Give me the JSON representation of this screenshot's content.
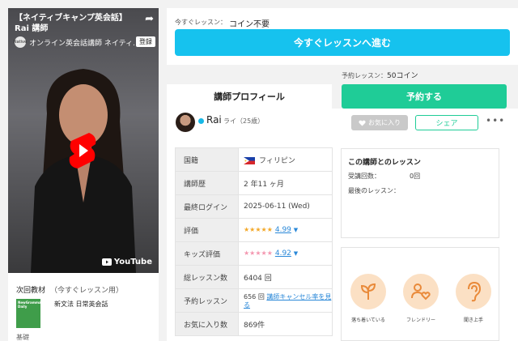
{
  "video": {
    "title": "【ネイティブキャンプ英会話】Rai 講師",
    "channel": "オンライン英会話講師 ネイティ...",
    "channel_icon_text": "Native",
    "subscribe": "登録",
    "brand": "YouTube"
  },
  "next_material": {
    "heading": "次回教材",
    "subheading": "（今すぐレッスン用）",
    "book_cover_text": "NewGrammar Daily",
    "book_title": "新文法 日常英会話",
    "level": "基礎"
  },
  "instant": {
    "label": "今すぐレッスン：",
    "value": "コイン不要",
    "button": "今すぐレッスンへ進む"
  },
  "reserve": {
    "price_label": "予約レッスン：",
    "price_value": "50コイン",
    "button": "予約する"
  },
  "tabs": {
    "profile": "講師プロフィール"
  },
  "teacher": {
    "name": "Rai",
    "kana_age": "ライ（25歳）",
    "favorite_button": "お気に入り",
    "share_button": "シェア",
    "more": "•••"
  },
  "profile_table": {
    "nationality_label": "国籍",
    "nationality_value": "フィリピン",
    "experience_label": "講師歴",
    "experience_value": "2 年11 ヶ月",
    "last_login_label": "最終ログイン",
    "last_login_value": "2025-06-11 (Wed)",
    "rating_label": "評価",
    "rating_value": "4.99",
    "rating_stars": "★★★★★",
    "kids_rating_label": "キッズ評価",
    "kids_rating_value": "4.92",
    "kids_rating_stars": "★★★★★",
    "total_lessons_label": "総レッスン数",
    "total_lessons_value": "6404 回",
    "reserved_label": "予約レッスン",
    "reserved_count": "656 回",
    "reserved_link": "講師キャンセル率を見る",
    "favorites_label": "お気に入り数",
    "favorites_value": "869件"
  },
  "lessons_with_teacher": {
    "title": "この講師とのレッスン",
    "count_label": "受講回数：",
    "count_value": "0回",
    "last_label": "最後のレッスン："
  },
  "traits": [
    {
      "label": "落ち着いている",
      "icon": "sprout-icon"
    },
    {
      "label": "フレンドリー",
      "icon": "friends-icon"
    },
    {
      "label": "聞き上手",
      "icon": "ear-icon"
    }
  ],
  "colors": {
    "instant_button": "#16c2ee",
    "reserve_button": "#1fcc97",
    "link": "#2a88d8",
    "star": "#f3a828",
    "kids_star": "#f497b0",
    "trait_circle": "#fbe0c4",
    "trait_icon": "#e98a3a"
  }
}
